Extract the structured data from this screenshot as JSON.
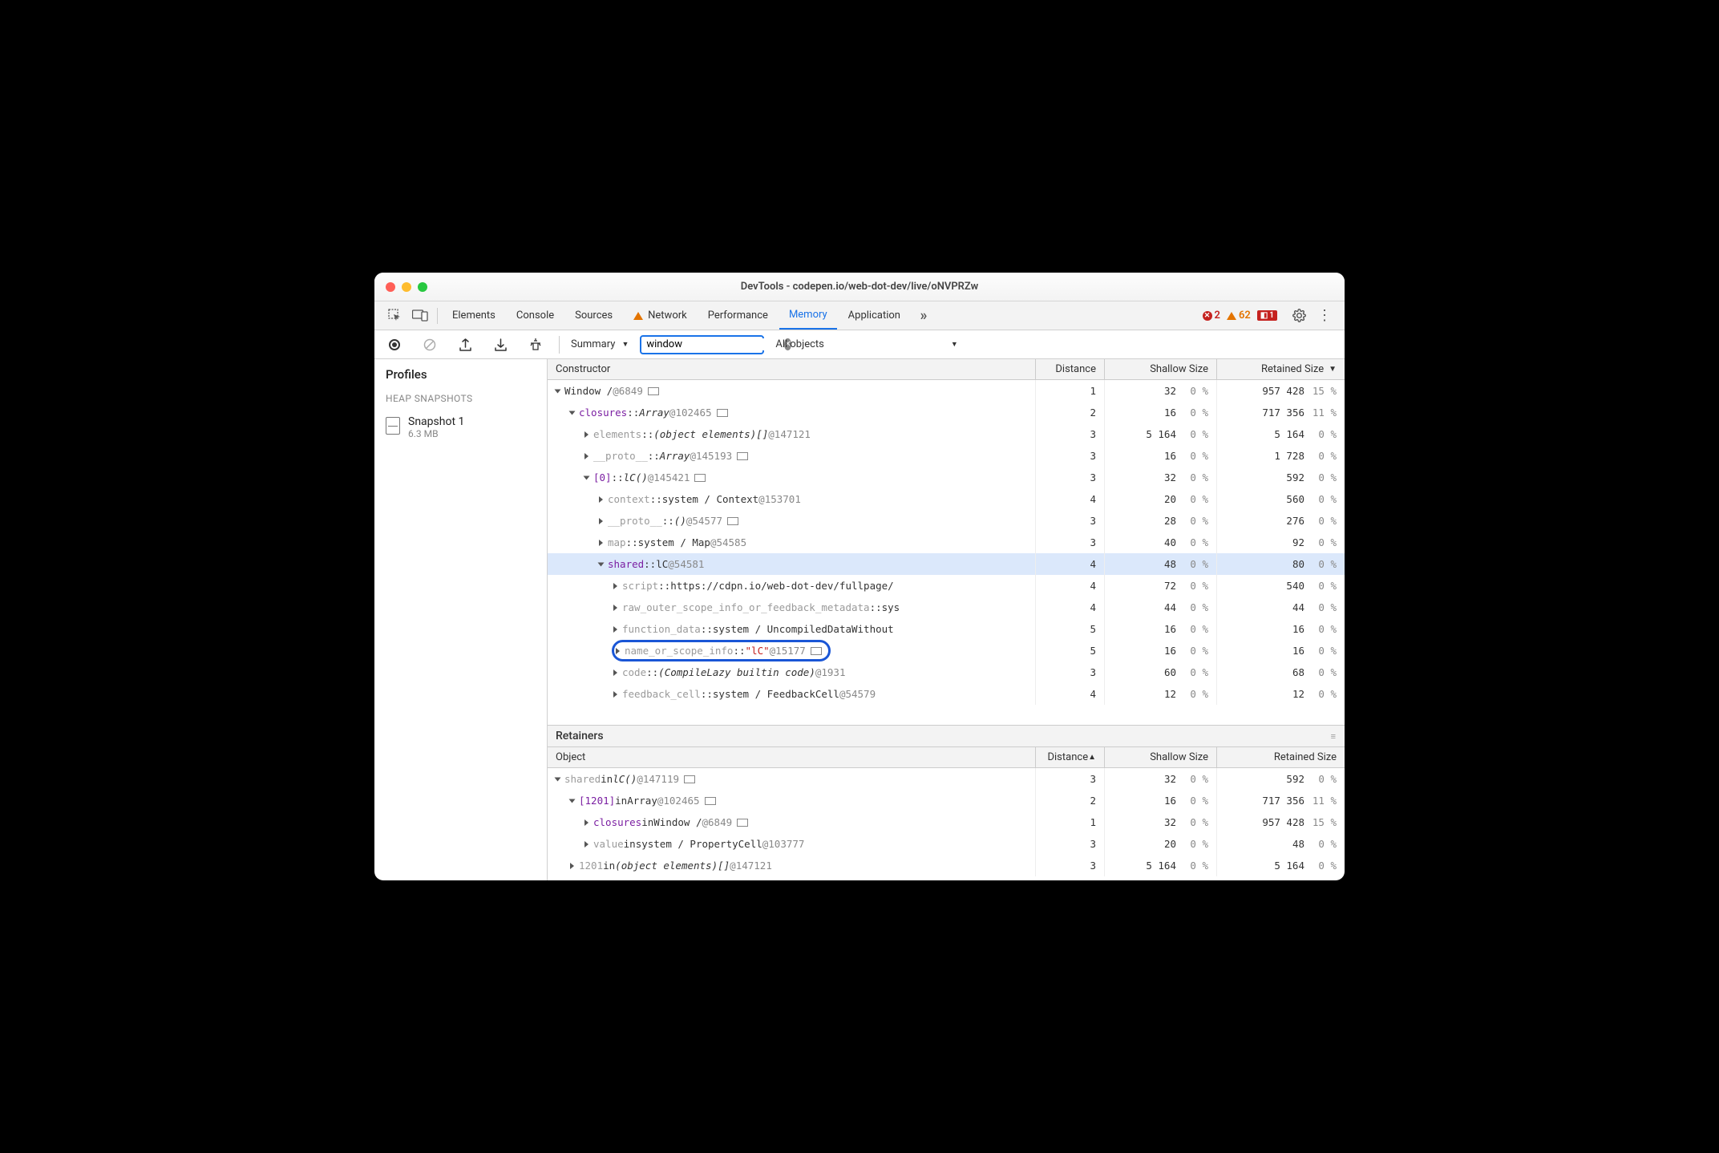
{
  "window": {
    "title": "DevTools - codepen.io/web-dot-dev/live/oNVPRZw"
  },
  "tabs": [
    "Elements",
    "Console",
    "Sources",
    "Network",
    "Performance",
    "Memory",
    "Application"
  ],
  "active_tab": "Memory",
  "status": {
    "errors": 2,
    "warnings": 62,
    "issues": 1
  },
  "toolbar": {
    "view": "Summary",
    "filter": "window",
    "scope": "All objects"
  },
  "sidebar": {
    "title": "Profiles",
    "group": "HEAP SNAPSHOTS",
    "snapshot": {
      "name": "Snapshot 1",
      "size": "6.3 MB"
    }
  },
  "headers": {
    "constructor": "Constructor",
    "distance": "Distance",
    "shallow": "Shallow Size",
    "retained": "Retained Size",
    "object": "Object"
  },
  "retainers_title": "Retainers",
  "rows": [
    {
      "indent": 0,
      "open": true,
      "parts": [
        {
          "t": "Window / ",
          "c": ""
        },
        {
          "t": "@6849",
          "c": "id"
        },
        {
          "box": 1
        }
      ],
      "d": "1",
      "sv": "32",
      "sp": "0 %",
      "rv": "957 428",
      "rp": "15 %"
    },
    {
      "indent": 1,
      "open": true,
      "parts": [
        {
          "t": "closures",
          "c": "idx0"
        },
        {
          "t": " :: ",
          "c": ""
        },
        {
          "t": "Array",
          "c": "arr"
        },
        {
          "t": " @102465",
          "c": "id"
        },
        {
          "box": 1
        }
      ],
      "d": "2",
      "sv": "16",
      "sp": "0 %",
      "rv": "717 356",
      "rp": "11 %"
    },
    {
      "indent": 2,
      "open": false,
      "parts": [
        {
          "t": "elements",
          "c": "prop"
        },
        {
          "t": " :: ",
          "c": ""
        },
        {
          "t": "(object elements)[]",
          "c": "arr"
        },
        {
          "t": " @147121",
          "c": "id"
        }
      ],
      "d": "3",
      "sv": "5 164",
      "sp": "0 %",
      "rv": "5 164",
      "rp": "0 %"
    },
    {
      "indent": 2,
      "open": false,
      "parts": [
        {
          "t": "__proto__",
          "c": "prop"
        },
        {
          "t": " :: ",
          "c": ""
        },
        {
          "t": "Array",
          "c": "arr"
        },
        {
          "t": " @145193",
          "c": "id"
        },
        {
          "box": 1
        }
      ],
      "d": "3",
      "sv": "16",
      "sp": "0 %",
      "rv": "1 728",
      "rp": "0 %"
    },
    {
      "indent": 2,
      "open": true,
      "parts": [
        {
          "t": "[0]",
          "c": "idx0"
        },
        {
          "t": " :: ",
          "c": ""
        },
        {
          "t": "lC()",
          "c": "arr"
        },
        {
          "t": " @145421",
          "c": "id"
        },
        {
          "box": 1
        }
      ],
      "d": "3",
      "sv": "32",
      "sp": "0 %",
      "rv": "592",
      "rp": "0 %"
    },
    {
      "indent": 3,
      "open": false,
      "parts": [
        {
          "t": "context",
          "c": "prop"
        },
        {
          "t": " :: ",
          "c": ""
        },
        {
          "t": "system / Context",
          "c": ""
        },
        {
          "t": " @153701",
          "c": "id"
        }
      ],
      "d": "4",
      "sv": "20",
      "sp": "0 %",
      "rv": "560",
      "rp": "0 %"
    },
    {
      "indent": 3,
      "open": false,
      "parts": [
        {
          "t": "__proto__",
          "c": "prop"
        },
        {
          "t": " :: ",
          "c": ""
        },
        {
          "t": "()",
          "c": "arr"
        },
        {
          "t": " @54577",
          "c": "id"
        },
        {
          "box": 1
        }
      ],
      "d": "3",
      "sv": "28",
      "sp": "0 %",
      "rv": "276",
      "rp": "0 %"
    },
    {
      "indent": 3,
      "open": false,
      "parts": [
        {
          "t": "map",
          "c": "prop"
        },
        {
          "t": " :: ",
          "c": ""
        },
        {
          "t": "system / Map",
          "c": ""
        },
        {
          "t": " @54585",
          "c": "id"
        }
      ],
      "d": "3",
      "sv": "40",
      "sp": "0 %",
      "rv": "92",
      "rp": "0 %"
    },
    {
      "indent": 3,
      "open": true,
      "sel": true,
      "parts": [
        {
          "t": "shared",
          "c": "idx0"
        },
        {
          "t": " :: ",
          "c": ""
        },
        {
          "t": "lC",
          "c": ""
        },
        {
          "t": " @54581",
          "c": "id"
        }
      ],
      "d": "4",
      "sv": "48",
      "sp": "0 %",
      "rv": "80",
      "rp": "0 %"
    },
    {
      "indent": 4,
      "open": false,
      "parts": [
        {
          "t": "script",
          "c": "prop"
        },
        {
          "t": " :: ",
          "c": ""
        },
        {
          "t": "https://cdpn.io/web-dot-dev/fullpage/",
          "c": ""
        }
      ],
      "d": "4",
      "sv": "72",
      "sp": "0 %",
      "rv": "540",
      "rp": "0 %"
    },
    {
      "indent": 4,
      "open": false,
      "parts": [
        {
          "t": "raw_outer_scope_info_or_feedback_metadata",
          "c": "prop"
        },
        {
          "t": " :: ",
          "c": ""
        },
        {
          "t": "sys",
          "c": ""
        }
      ],
      "d": "4",
      "sv": "44",
      "sp": "0 %",
      "rv": "44",
      "rp": "0 %"
    },
    {
      "indent": 4,
      "open": false,
      "parts": [
        {
          "t": "function_data",
          "c": "prop"
        },
        {
          "t": " :: ",
          "c": ""
        },
        {
          "t": "system / UncompiledDataWithout",
          "c": ""
        }
      ],
      "d": "5",
      "sv": "16",
      "sp": "0 %",
      "rv": "16",
      "rp": "0 %"
    },
    {
      "indent": 4,
      "open": false,
      "circled": true,
      "parts": [
        {
          "t": "name_or_scope_info",
          "c": "prop"
        },
        {
          "t": " :: ",
          "c": ""
        },
        {
          "t": "\"lC\"",
          "c": "str"
        },
        {
          "t": " @15177",
          "c": "id"
        },
        {
          "box": 1
        }
      ],
      "d": "5",
      "sv": "16",
      "sp": "0 %",
      "rv": "16",
      "rp": "0 %"
    },
    {
      "indent": 4,
      "open": false,
      "parts": [
        {
          "t": "code",
          "c": "prop"
        },
        {
          "t": " :: ",
          "c": ""
        },
        {
          "t": "(CompileLazy builtin code)",
          "c": "arr"
        },
        {
          "t": " @1931",
          "c": "id"
        }
      ],
      "d": "3",
      "sv": "60",
      "sp": "0 %",
      "rv": "68",
      "rp": "0 %"
    },
    {
      "indent": 4,
      "open": false,
      "parts": [
        {
          "t": "feedback_cell",
          "c": "prop"
        },
        {
          "t": " :: ",
          "c": ""
        },
        {
          "t": "system / FeedbackCell",
          "c": ""
        },
        {
          "t": " @54579",
          "c": "id"
        }
      ],
      "d": "4",
      "sv": "12",
      "sp": "0 %",
      "rv": "12",
      "rp": "0 %"
    }
  ],
  "retainers": [
    {
      "indent": 0,
      "open": true,
      "parts": [
        {
          "t": "shared",
          "c": "prop"
        },
        {
          "t": " in ",
          "c": ""
        },
        {
          "t": "lC()",
          "c": "arr"
        },
        {
          "t": " @147119",
          "c": "id"
        },
        {
          "box": 1
        }
      ],
      "d": "3",
      "sv": "32",
      "sp": "0 %",
      "rv": "592",
      "rp": "0 %"
    },
    {
      "indent": 1,
      "open": true,
      "parts": [
        {
          "t": "[1201]",
          "c": "idx0"
        },
        {
          "t": " in ",
          "c": ""
        },
        {
          "t": "Array",
          "c": ""
        },
        {
          "t": " @102465",
          "c": "id"
        },
        {
          "box": 1
        }
      ],
      "d": "2",
      "sv": "16",
      "sp": "0 %",
      "rv": "717 356",
      "rp": "11 %"
    },
    {
      "indent": 2,
      "open": false,
      "parts": [
        {
          "t": "closures",
          "c": "idx0"
        },
        {
          "t": " in ",
          "c": ""
        },
        {
          "t": "Window / ",
          "c": ""
        },
        {
          "t": "@6849",
          "c": "id"
        },
        {
          "box": 1
        }
      ],
      "d": "1",
      "sv": "32",
      "sp": "0 %",
      "rv": "957 428",
      "rp": "15 %"
    },
    {
      "indent": 2,
      "open": false,
      "parts": [
        {
          "t": "value",
          "c": "prop"
        },
        {
          "t": " in ",
          "c": ""
        },
        {
          "t": "system / PropertyCell",
          "c": ""
        },
        {
          "t": " @103777",
          "c": "id"
        }
      ],
      "d": "3",
      "sv": "20",
      "sp": "0 %",
      "rv": "48",
      "rp": "0 %"
    },
    {
      "indent": 1,
      "open": false,
      "parts": [
        {
          "t": "1201",
          "c": "prop"
        },
        {
          "t": " in ",
          "c": ""
        },
        {
          "t": "(object elements)[]",
          "c": "arr"
        },
        {
          "t": " @147121",
          "c": "id"
        }
      ],
      "d": "3",
      "sv": "5 164",
      "sp": "0 %",
      "rv": "5 164",
      "rp": "0 %"
    }
  ]
}
